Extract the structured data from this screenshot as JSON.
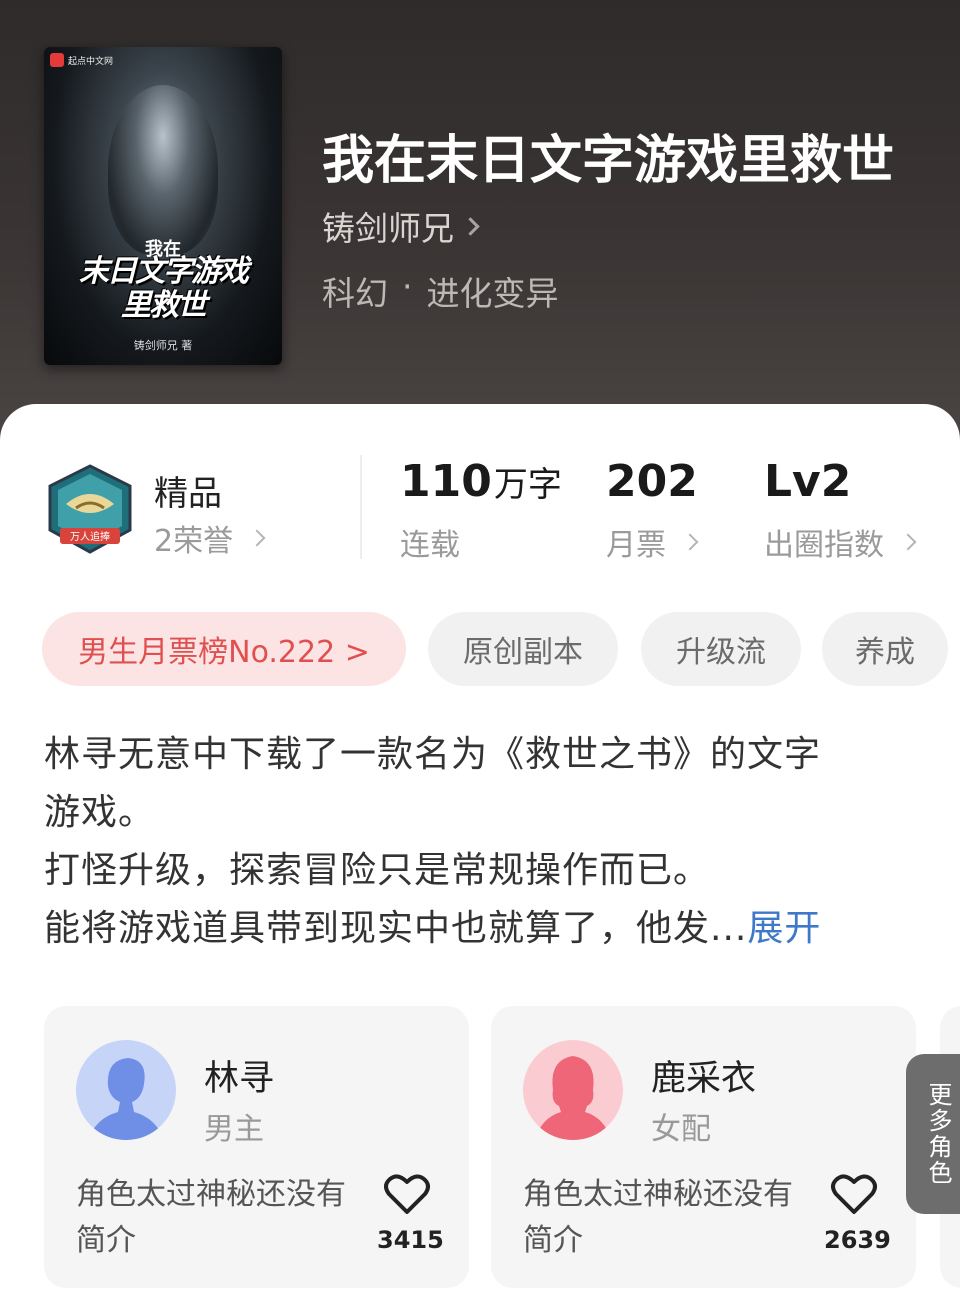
{
  "book": {
    "title": "我在末日文字游戏里救世",
    "author": "铸剑师兄",
    "genre": "科幻",
    "genre_separator": "·",
    "subgenre": "进化变异",
    "cover": {
      "brand": "起点中文网",
      "small_title": "我在",
      "big_title_line1": "末日文字游戏",
      "big_title_line2": "里救世",
      "author_mark": "铸剑师兄 著"
    }
  },
  "stats": {
    "badge_ribbon": "万人追捧",
    "quality": "精品",
    "honors": "2荣誉",
    "word_count": "110",
    "word_unit": "万字",
    "status": "连载",
    "monthly_tickets": "202",
    "monthly_tickets_label": "月票",
    "influence_level": "Lv2",
    "influence_label": "出圈指数"
  },
  "tags": {
    "rank": "男生月票榜No.222 >",
    "items": [
      "原创副本",
      "升级流",
      "养成"
    ]
  },
  "synopsis": {
    "line1": "林寻无意中下载了一款名为《救世之书》的文字",
    "line2": "游戏。",
    "line3": "打怪升级，探索冒险只是常规操作而已。",
    "line4": "能将游戏道具带到现实中也就算了，他发...",
    "expand": "展开"
  },
  "characters": [
    {
      "name": "林寻",
      "role": "男主",
      "desc": "角色太过神秘还没有简介",
      "likes": "3415"
    },
    {
      "name": "鹿采衣",
      "role": "女配",
      "desc": "角色太过神秘还没有简介",
      "likes": "2639"
    }
  ],
  "more_roles": "更多角色",
  "colors": {
    "accent_red": "#e05050",
    "link_blue": "#3f78c8",
    "male_avatar": "#6f8fe6",
    "female_avatar": "#ee6677"
  }
}
